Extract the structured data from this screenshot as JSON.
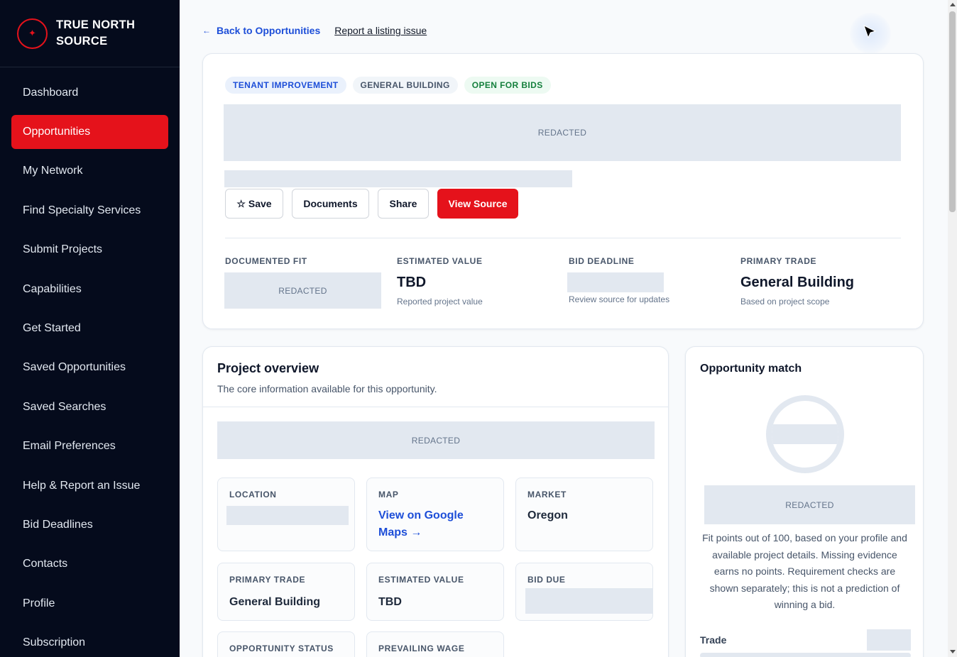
{
  "brand": {
    "name_line1": "TRUE NORTH",
    "name_line2": "SOURCE",
    "logo_glyph": "✦",
    "accent": "#e5121b"
  },
  "sidebar": {
    "items": [
      {
        "label": "Dashboard",
        "active": false
      },
      {
        "label": "Opportunities",
        "active": true
      },
      {
        "label": "My Network",
        "active": false
      },
      {
        "label": "Find Specialty Services",
        "active": false
      },
      {
        "label": "Submit Projects",
        "active": false
      },
      {
        "label": "Capabilities",
        "active": false
      },
      {
        "label": "Get Started",
        "active": false
      },
      {
        "label": "Saved Opportunities",
        "active": false
      },
      {
        "label": "Saved Searches",
        "active": false
      },
      {
        "label": "Email Preferences",
        "active": false
      },
      {
        "label": "Help & Report an Issue",
        "active": false
      },
      {
        "label": "Bid Deadlines",
        "active": false
      },
      {
        "label": "Contacts",
        "active": false
      },
      {
        "label": "Profile",
        "active": false
      },
      {
        "label": "Subscription",
        "active": false
      }
    ]
  },
  "topbar": {
    "back_arrow": "←",
    "back_label": "Back to Opportunities",
    "report_label": "Report a listing issue"
  },
  "hero": {
    "tags": [
      {
        "label": "TENANT IMPROVEMENT",
        "style": "blue"
      },
      {
        "label": "GENERAL BUILDING",
        "style": "gray"
      },
      {
        "label": "OPEN FOR BIDS",
        "style": "green"
      }
    ],
    "title_redacted": "REDACTED",
    "actions": {
      "save": "☆ Save",
      "documents": "Documents",
      "share": "Share",
      "view_source": "View Source"
    },
    "stats": {
      "fit": {
        "label": "DOCUMENTED FIT",
        "value": "REDACTED"
      },
      "value": {
        "label": "ESTIMATED VALUE",
        "value": "TBD",
        "sub": "Reported project value"
      },
      "deadline": {
        "label": "BID DEADLINE",
        "sub": "Review source for updates"
      },
      "trade": {
        "label": "PRIMARY TRADE",
        "value": "General Building",
        "sub": "Based on project scope"
      }
    }
  },
  "overview": {
    "title": "Project overview",
    "subtitle": "The core information available for this opportunity.",
    "redacted": "REDACTED",
    "tiles": {
      "location": {
        "label": "LOCATION"
      },
      "map": {
        "label": "MAP",
        "link_line1": "View on Google",
        "link_line2": "Maps →"
      },
      "market": {
        "label": "MARKET",
        "value": "Oregon"
      },
      "primary_trade": {
        "label": "PRIMARY TRADE",
        "value": "General Building"
      },
      "est_value": {
        "label": "ESTIMATED VALUE",
        "value": "TBD"
      },
      "bid_due": {
        "label": "BID DUE"
      },
      "status": {
        "label": "OPPORTUNITY STATUS"
      },
      "wage": {
        "label": "PREVAILING WAGE"
      }
    }
  },
  "match": {
    "title": "Opportunity match",
    "redacted": "REDACTED",
    "description": "Fit points out of 100, based on your profile and available project details. Missing evidence earns no points. Requirement checks are shown separately; this is not a prediction of winning a bid.",
    "trade_label": "Trade"
  }
}
